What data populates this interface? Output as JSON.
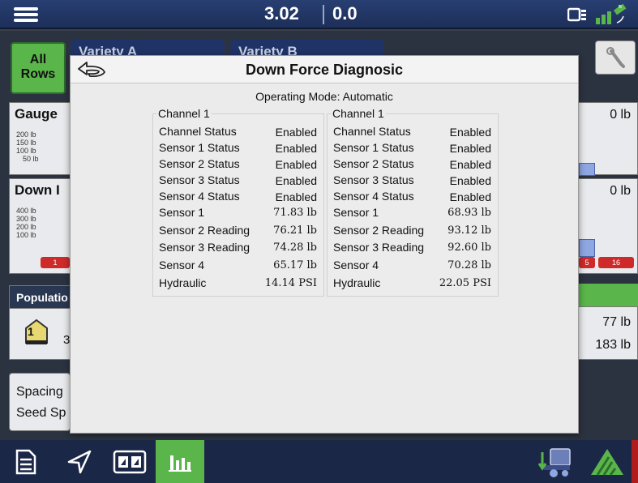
{
  "topbar": {
    "speed": "3.02",
    "rate": "0.0",
    "display_icon": "display-switch-icon",
    "gps_icon": "gps-signal-icon"
  },
  "background": {
    "all_rows_label_line1": "All",
    "all_rows_label_line2": "Rows",
    "variety_tabs": [
      "Variety A",
      "Variety B"
    ],
    "gauge_panel": {
      "title": "Gauge",
      "scale": [
        "200 lb",
        "150 lb",
        "100 lb",
        "50 lb"
      ],
      "right_value": "0 lb"
    },
    "down_panel": {
      "title": "Down I",
      "scale": [
        "400 lb",
        "300 lb",
        "200 lb",
        "100 lb"
      ],
      "right_value": "0 lb",
      "red_cells": [
        "1",
        "5",
        "16"
      ]
    },
    "population_title": "Populatio",
    "population_value": "1",
    "population_partial": "3",
    "right_values": [
      "77 lb",
      "183 lb"
    ],
    "spacing_lines": [
      "Spacing",
      "Seed Sp"
    ]
  },
  "dialog": {
    "title": "Down Force Diagnosic",
    "operating_mode": "Operating Mode: Automatic",
    "channels": [
      {
        "legend": "Channel 1",
        "rows": [
          {
            "label": "Channel Status",
            "value": "Enabled"
          },
          {
            "label": "Sensor 1 Status",
            "value": "Enabled"
          },
          {
            "label": "Sensor 2 Status",
            "value": "Enabled"
          },
          {
            "label": "Sensor 3 Status",
            "value": "Enabled"
          },
          {
            "label": "Sensor 4 Status",
            "value": "Enabled"
          },
          {
            "label": "Sensor 1",
            "value": "71.83 lb"
          },
          {
            "label": "Sensor 2 Reading",
            "value": "76.21 lb"
          },
          {
            "label": "Sensor 3 Reading",
            "value": "74.28 lb"
          },
          {
            "label": "Sensor 4",
            "value": "65.17 lb"
          },
          {
            "label": "Hydraulic",
            "value": "14.14 PSI"
          }
        ]
      },
      {
        "legend": "Channel 1",
        "rows": [
          {
            "label": "Channel Status",
            "value": "Enabled"
          },
          {
            "label": "Sensor 1 Status",
            "value": "Enabled"
          },
          {
            "label": "Sensor 2 Status",
            "value": "Enabled"
          },
          {
            "label": "Sensor 3 Status",
            "value": "Enabled"
          },
          {
            "label": "Sensor 4 Status",
            "value": "Enabled"
          },
          {
            "label": "Sensor 1",
            "value": "68.93 lb"
          },
          {
            "label": "Sensor 2 Reading",
            "value": "93.12 lb"
          },
          {
            "label": "Sensor 3 Reading",
            "value": "92.60 lb"
          },
          {
            "label": "Sensor 4",
            "value": "70.28 lb"
          },
          {
            "label": "Hydraulic",
            "value": "22.05 PSI"
          }
        ]
      }
    ]
  },
  "bottombar": {
    "buttons": [
      {
        "icon": "document-icon",
        "active": false
      },
      {
        "icon": "navigation-arrow-icon",
        "active": false
      },
      {
        "icon": "split-map-icon",
        "active": false
      },
      {
        "icon": "bar-chart-icon",
        "active": true
      },
      {
        "icon": "planter-icon",
        "active": false
      },
      {
        "icon": "field-green-icon",
        "active": false
      }
    ]
  },
  "colors": {
    "header_blue": "#1d2f59",
    "accent_green": "#5ab54a",
    "dialog_bg": "#ebebeb",
    "alert_red": "#cf2a2a"
  }
}
